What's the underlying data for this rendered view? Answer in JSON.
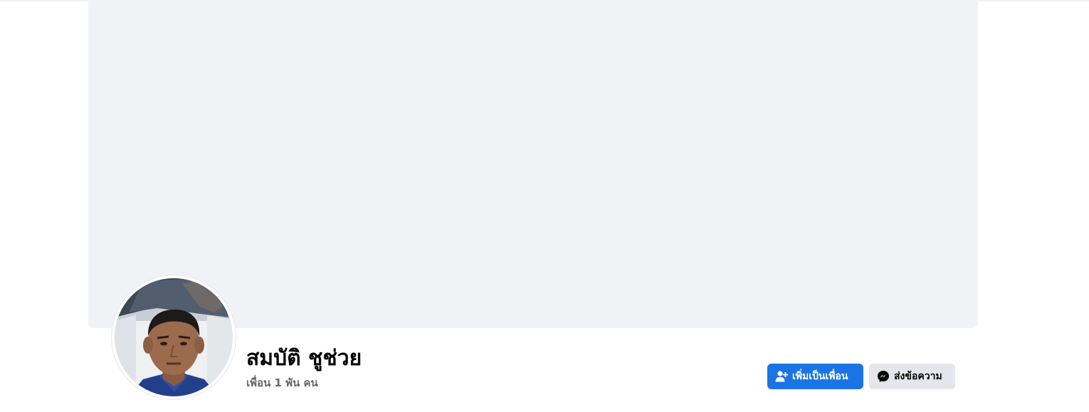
{
  "profile": {
    "name": "สมบัติ ชูช่วย",
    "friends_count": "เพื่อน 1 พัน คน"
  },
  "actions": {
    "add_friend_label": "เพิ่มเป็นเพื่อน",
    "add_friend_icon": "add-friend-icon",
    "message_label": "ส่งข้อความ",
    "message_icon": "messenger-icon"
  },
  "colors": {
    "primary": "#1b74e4",
    "secondary_button": "#e4e6eb",
    "cover_placeholder": "#f0f2f5"
  }
}
